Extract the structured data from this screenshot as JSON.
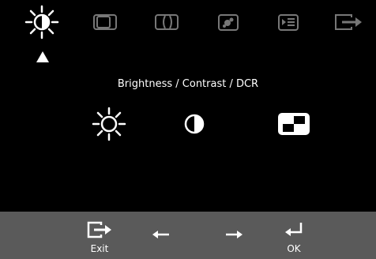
{
  "screen_title": "Brightness / Contrast / DCR",
  "tabs": [
    {
      "icon": "brightness-icon",
      "active": true
    },
    {
      "icon": "image-position-icon",
      "active": false
    },
    {
      "icon": "image-setup-icon",
      "active": false
    },
    {
      "icon": "image-properties-icon",
      "active": false
    },
    {
      "icon": "options-icon",
      "active": false
    },
    {
      "icon": "exit-icon",
      "active": false
    }
  ],
  "options": [
    {
      "icon": "brightness-icon"
    },
    {
      "icon": "contrast-icon"
    },
    {
      "icon": "dcr-icon"
    }
  ],
  "footer": {
    "exit_label": "Exit",
    "ok_label": "OK",
    "buttons": [
      {
        "icon": "exit-icon"
      },
      {
        "icon": "arrow-left-icon"
      },
      {
        "icon": "arrow-right-icon"
      },
      {
        "icon": "enter-icon"
      }
    ]
  },
  "colors": {
    "background": "#000000",
    "footer": "#5a5a5a",
    "foreground": "#ffffff"
  }
}
